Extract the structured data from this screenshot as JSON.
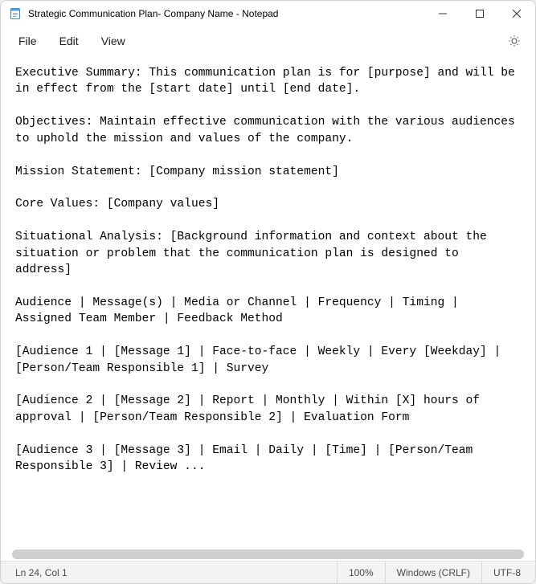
{
  "titlebar": {
    "title": "Strategic Communication Plan- Company Name - Notepad"
  },
  "menu": {
    "file": "File",
    "edit": "Edit",
    "view": "View"
  },
  "document_text": "Executive Summary: This communication plan is for [purpose] and will be in effect from the [start date] until [end date].\n\nObjectives: Maintain effective communication with the various audiences to uphold the mission and values of the company.\n\nMission Statement: [Company mission statement]\n\nCore Values: [Company values]\n\nSituational Analysis: [Background information and context about the situation or problem that the communication plan is designed to address]\n\nAudience | Message(s) | Media or Channel | Frequency | Timing | Assigned Team Member | Feedback Method\n\n[Audience 1 | [Message 1] | Face-to-face | Weekly | Every [Weekday] | [Person/Team Responsible 1] | Survey\n\n[Audience 2 | [Message 2] | Report | Monthly | Within [X] hours of approval | [Person/Team Responsible 2] | Evaluation Form\n\n[Audience 3 | [Message 3] | Email | Daily | [Time] | [Person/Team Responsible 3] | Review ...",
  "statusbar": {
    "position": "Ln 24, Col 1",
    "zoom": "100%",
    "line_ending": "Windows (CRLF)",
    "encoding": "UTF-8"
  }
}
